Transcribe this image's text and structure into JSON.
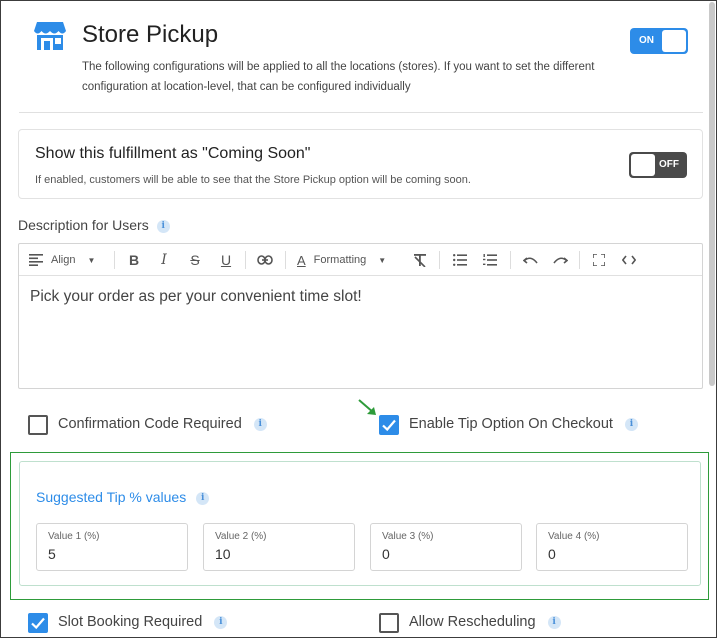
{
  "header": {
    "title": "Store Pickup",
    "description": "The following configurations will be applied to all the locations (stores). If you want to set the different configuration at location-level, that can be configured individually",
    "toggle_label": "ON",
    "toggle_state": "on",
    "accent_color": "#2d8ce8"
  },
  "coming_soon": {
    "title": "Show this fulfillment as \"Coming Soon\"",
    "description": "If enabled, customers will be able to see that the Store Pickup option will be coming soon.",
    "toggle_label": "OFF",
    "toggle_state": "off"
  },
  "description_field": {
    "label": "Description for Users",
    "toolbar": {
      "align_label": "Align",
      "formatting_label": "Formatting"
    },
    "content": "Pick your order as per your convenient time slot!"
  },
  "options": {
    "confirmation_code_label": "Confirmation Code Required",
    "confirmation_code_checked": false,
    "tip_option_label": "Enable Tip Option On Checkout",
    "tip_option_checked": true,
    "slot_booking_label": "Slot Booking Required",
    "slot_booking_checked": true,
    "rescheduling_label": "Allow Rescheduling",
    "rescheduling_checked": false
  },
  "tips": {
    "title": "Suggested Tip % values",
    "values": [
      {
        "label": "Value 1 (%)",
        "value": "5"
      },
      {
        "label": "Value 2 (%)",
        "value": "10"
      },
      {
        "label": "Value 3 (%)",
        "value": "0"
      },
      {
        "label": "Value 4 (%)",
        "value": "0"
      }
    ],
    "highlight_color": "#2e9b3a"
  }
}
